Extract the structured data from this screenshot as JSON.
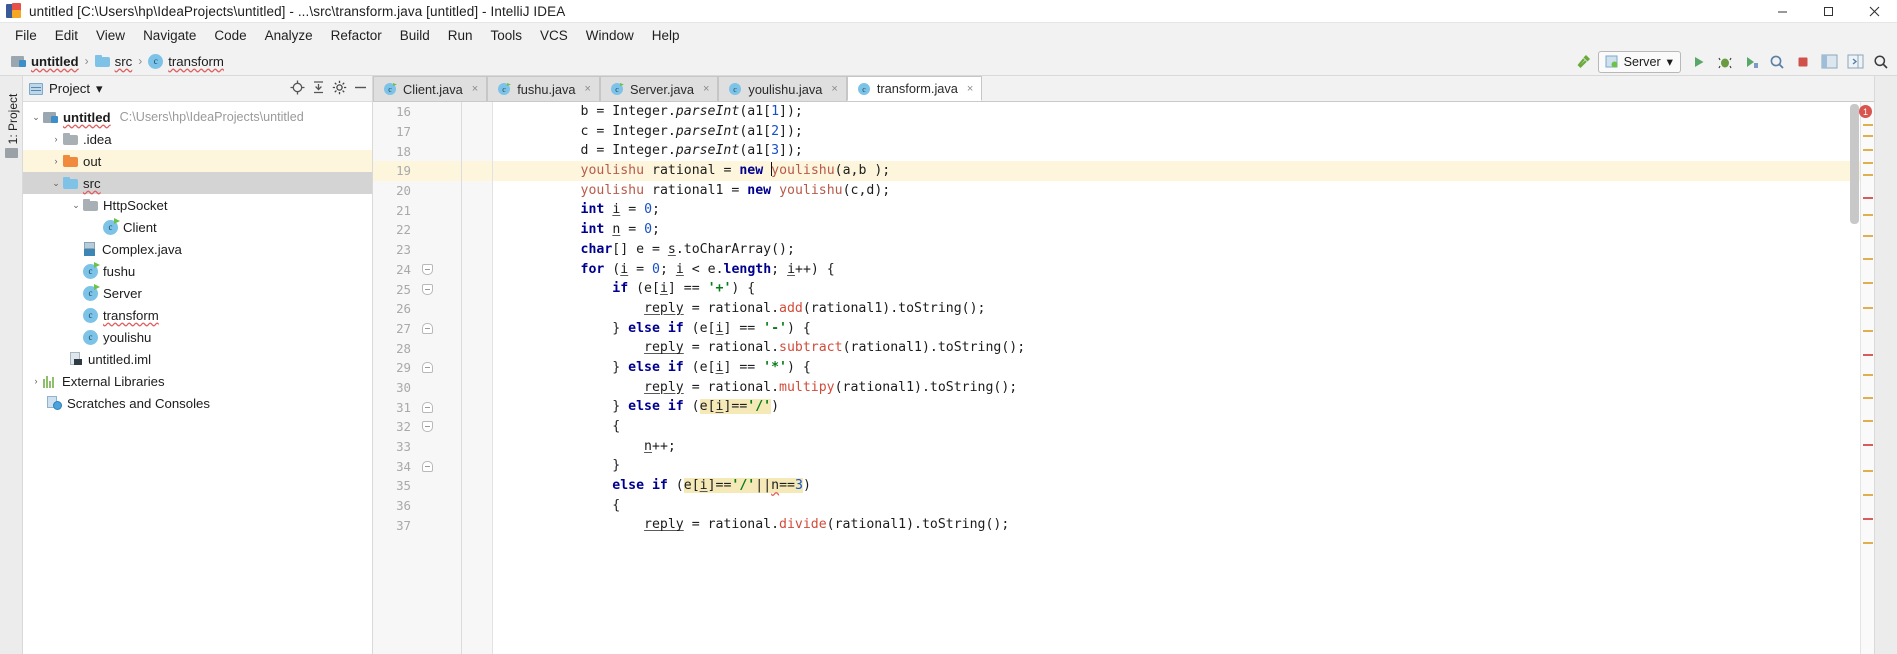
{
  "window": {
    "title": "untitled [C:\\Users\\hp\\IdeaProjects\\untitled] - ...\\src\\transform.java [untitled] - IntelliJ IDEA",
    "minimize_label": "Minimize",
    "maximize_label": "Maximize",
    "close_label": "Close"
  },
  "menubar": {
    "items": [
      {
        "label": "File"
      },
      {
        "label": "Edit"
      },
      {
        "label": "View"
      },
      {
        "label": "Navigate"
      },
      {
        "label": "Code"
      },
      {
        "label": "Analyze"
      },
      {
        "label": "Refactor"
      },
      {
        "label": "Build"
      },
      {
        "label": "Run"
      },
      {
        "label": "Tools"
      },
      {
        "label": "VCS"
      },
      {
        "label": "Window"
      },
      {
        "label": "Help"
      }
    ]
  },
  "breadcrumb": {
    "items": [
      {
        "label": "untitled",
        "icon": "module-icon"
      },
      {
        "label": "src",
        "icon": "folder-icon"
      },
      {
        "label": "transform",
        "icon": "class-icon"
      }
    ],
    "separator": "›"
  },
  "toolbar": {
    "run_config": "Server",
    "run_config_dropdown": "▾",
    "build_icon": "hammer-icon",
    "run_icon": "run-icon",
    "debug_icon": "debug-icon",
    "coverage_icon": "coverage-icon",
    "profile_icon": "profile-icon",
    "stop_icon": "stop-icon",
    "layout_icon": "layout-icon",
    "preview_icon": "preview-icon",
    "search_icon": "search-icon"
  },
  "sidebar": {
    "strip_label": "1: Project",
    "panel_title": "Project",
    "panel_dropdown": "▾",
    "action_locate": "locate-icon",
    "action_collapse": "collapse-all-icon",
    "action_settings": "gear-icon",
    "action_hide": "hide-icon",
    "tree": [
      {
        "label": "untitled",
        "path": "C:\\Users\\hp\\IdeaProjects\\untitled",
        "indent": 0,
        "arrow": "⌄",
        "icon": "module-icon",
        "bold": true,
        "state": "normal"
      },
      {
        "label": ".idea",
        "indent": 1,
        "arrow": "›",
        "icon": "folder-gray-icon",
        "state": "normal"
      },
      {
        "label": "out",
        "indent": 1,
        "arrow": "›",
        "icon": "folder-orange-icon",
        "state": "highlight"
      },
      {
        "label": "src",
        "indent": 1,
        "arrow": "⌄",
        "icon": "folder-icon",
        "state": "selected"
      },
      {
        "label": "HttpSocket",
        "indent": 2,
        "arrow": "⌄",
        "icon": "folder-gray-icon",
        "state": "normal"
      },
      {
        "label": "Client",
        "indent": 3,
        "arrow": "",
        "icon": "class-runnable-icon",
        "state": "normal"
      },
      {
        "label": "Complex.java",
        "indent": 2,
        "arrow": "",
        "icon": "java-file-icon",
        "state": "normal"
      },
      {
        "label": "fushu",
        "indent": 2,
        "arrow": "",
        "icon": "class-runnable-icon",
        "state": "normal"
      },
      {
        "label": "Server",
        "indent": 2,
        "arrow": "",
        "icon": "class-runnable-icon",
        "state": "normal"
      },
      {
        "label": "transform",
        "indent": 2,
        "arrow": "",
        "icon": "class-icon",
        "state": "normal",
        "spellcheck": true
      },
      {
        "label": "youlishu",
        "indent": 2,
        "arrow": "",
        "icon": "class-icon",
        "state": "normal"
      },
      {
        "label": "untitled.iml",
        "indent": 1,
        "arrow": "",
        "icon": "iml-icon",
        "state": "normal"
      },
      {
        "label": "External Libraries",
        "indent": 0,
        "arrow": "›",
        "icon": "library-icon",
        "state": "normal"
      },
      {
        "label": "Scratches and Consoles",
        "indent": 0,
        "arrow": "",
        "icon": "scratches-icon",
        "state": "normal"
      }
    ]
  },
  "editor": {
    "tabs": [
      {
        "label": "Client.java",
        "icon": "java-runnable-icon",
        "active": false,
        "close": "×"
      },
      {
        "label": "fushu.java",
        "icon": "java-runnable-icon",
        "active": false,
        "close": "×"
      },
      {
        "label": "Server.java",
        "icon": "java-runnable-icon",
        "active": false,
        "close": "×"
      },
      {
        "label": "youlishu.java",
        "icon": "java-icon",
        "active": false,
        "close": "×"
      },
      {
        "label": "transform.java",
        "icon": "java-icon",
        "active": true,
        "close": "×"
      }
    ],
    "error_count": "1",
    "lines": [
      {
        "num": "16",
        "fold": "",
        "highlight": false
      },
      {
        "num": "17",
        "fold": "",
        "highlight": false
      },
      {
        "num": "18",
        "fold": "",
        "highlight": false
      },
      {
        "num": "19",
        "fold": "",
        "highlight": true
      },
      {
        "num": "20",
        "fold": "",
        "highlight": false
      },
      {
        "num": "21",
        "fold": "",
        "highlight": false
      },
      {
        "num": "22",
        "fold": "",
        "highlight": false
      },
      {
        "num": "23",
        "fold": "",
        "highlight": false
      },
      {
        "num": "24",
        "fold": "open",
        "highlight": false
      },
      {
        "num": "25",
        "fold": "open",
        "highlight": false
      },
      {
        "num": "26",
        "fold": "",
        "highlight": false
      },
      {
        "num": "27",
        "fold": "close",
        "highlight": false
      },
      {
        "num": "28",
        "fold": "",
        "highlight": false
      },
      {
        "num": "29",
        "fold": "close",
        "highlight": false
      },
      {
        "num": "30",
        "fold": "",
        "highlight": false
      },
      {
        "num": "31",
        "fold": "close",
        "highlight": false
      },
      {
        "num": "32",
        "fold": "open",
        "highlight": false
      },
      {
        "num": "33",
        "fold": "",
        "highlight": false
      },
      {
        "num": "34",
        "fold": "close",
        "highlight": false
      },
      {
        "num": "35",
        "fold": "",
        "highlight": false
      },
      {
        "num": "36",
        "fold": "",
        "highlight": false
      },
      {
        "num": "37",
        "fold": "",
        "highlight": false
      }
    ],
    "code": [
      "        b = Integer.parseInt(a1[1]);",
      "        c = Integer.parseInt(a1[2]);",
      "        d = Integer.parseInt(a1[3]);",
      "        youlishu rational = new youlishu(a,b );",
      "        youlishu rational1 = new youlishu(c,d);",
      "        int i = 0;",
      "        int n = 0;",
      "        char[] e = s.toCharArray();",
      "        for (i = 0; i < e.length; i++) {",
      "            if (e[i] == '+') {",
      "                reply = rational.add(rational1).toString();",
      "            } else if (e[i] == '-') {",
      "                reply = rational.subtract(rational1).toString();",
      "            } else if (e[i] == '*') {",
      "                reply = rational.multipy(rational1).toString();",
      "            } else if (e[i]=='/')",
      "            {",
      "                n++;",
      "            }",
      "            else if (e[i]=='/'||n==3)",
      "            {",
      "                reply = rational.divide(rational1).toString();"
    ]
  }
}
